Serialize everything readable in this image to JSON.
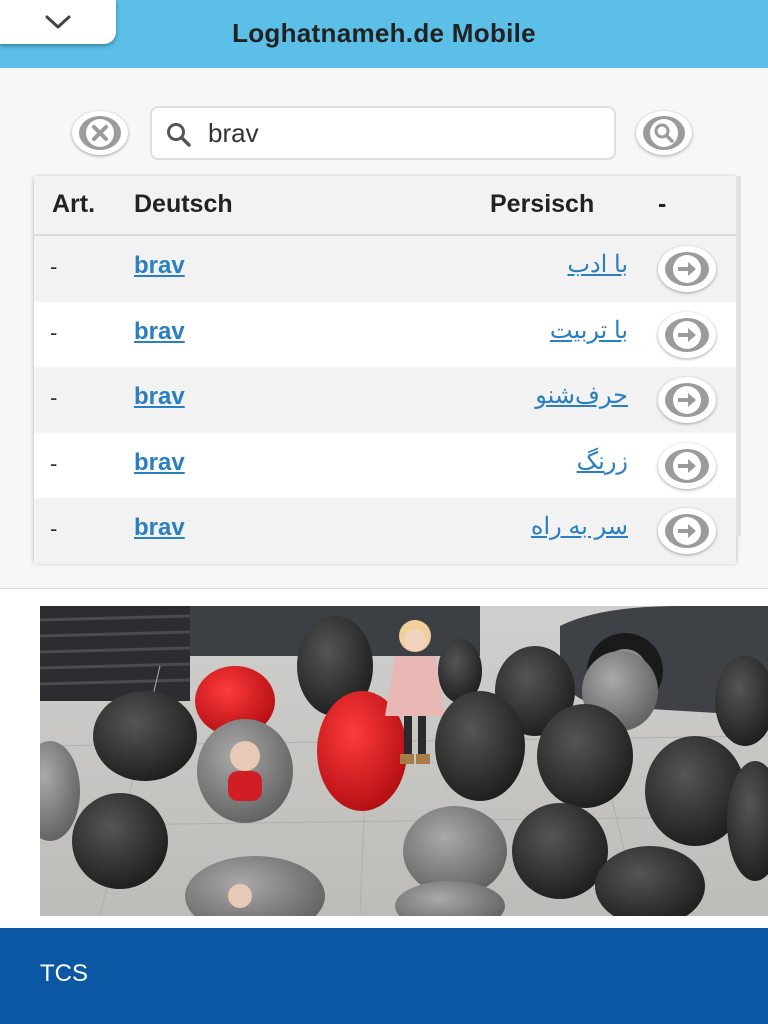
{
  "header": {
    "title": "Loghatnameh.de Mobile",
    "menu_icon": "chevron-down-icon"
  },
  "search": {
    "value": "brav",
    "clear_icon": "close-icon",
    "submit_icon": "search-icon"
  },
  "table": {
    "headers": {
      "art": "Art.",
      "deutsch": "Deutsch",
      "persisch": "Persisch",
      "action": "-"
    },
    "rows": [
      {
        "art": "-",
        "deutsch": "brav",
        "persisch": "با ادب"
      },
      {
        "art": "-",
        "deutsch": "brav",
        "persisch": "با تربیت"
      },
      {
        "art": "-",
        "deutsch": "brav",
        "persisch": "حرف‌شنو"
      },
      {
        "art": "-",
        "deutsch": "brav",
        "persisch": "زرنگ"
      },
      {
        "art": "-",
        "deutsch": "brav",
        "persisch": "سر به راه"
      }
    ],
    "row_icon": "arrow-right-icon"
  },
  "ad": {
    "brand": "TCS"
  },
  "colors": {
    "header_bg": "#5bbfe8",
    "link": "#2a7fc1",
    "footer_bg": "#0b57a4"
  }
}
